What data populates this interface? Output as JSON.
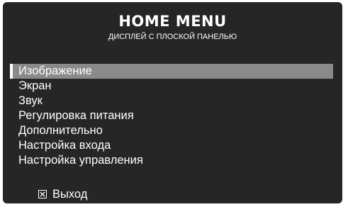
{
  "menu": {
    "title": "HOME MENU",
    "subtitle": "ДИСПЛЕЙ С ПЛОСКОЙ ПАНЕЛЬЮ",
    "selected_index": 0,
    "items": [
      {
        "label": "Изображение"
      },
      {
        "label": "Экран"
      },
      {
        "label": "Звук"
      },
      {
        "label": "Регулировка питания"
      },
      {
        "label": "Дополнительно"
      },
      {
        "label": "Настройка входа"
      },
      {
        "label": "Настройка управления"
      }
    ],
    "exit": {
      "icon": "close-box-icon",
      "label": "Выход"
    }
  },
  "colors": {
    "panel_background": "#262626",
    "highlight": "#8a8a8a",
    "text": "#ffffff"
  }
}
